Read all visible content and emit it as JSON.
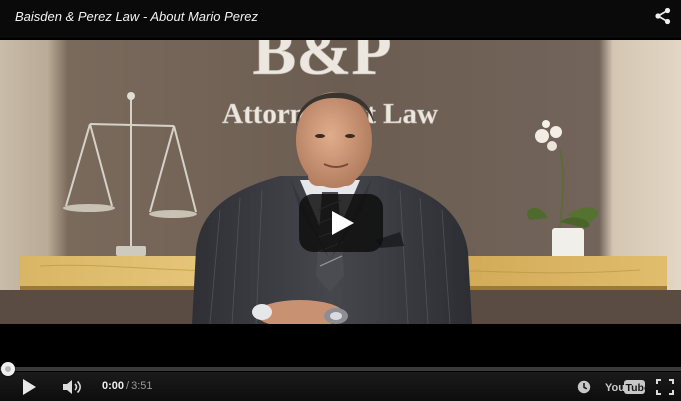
{
  "video": {
    "title": "Baisden & Perez Law - About Mario Perez",
    "sign_logo": "B&P",
    "sign_subtitle": "Attorneys at Law"
  },
  "player": {
    "current_time": "0:00",
    "time_separator": "/",
    "duration": "3:51",
    "progress_fraction": 0,
    "brand": "YouTube"
  },
  "icons": {
    "share": "share-icon",
    "big_play": "play-icon",
    "play": "play-icon",
    "volume": "volume-icon",
    "watch_later": "clock-icon",
    "youtube": "youtube-logo-icon",
    "fullscreen": "fullscreen-icon"
  },
  "colors": {
    "background": "#000000",
    "wall": "#6e6258",
    "marble_counter": "#d8b060",
    "suit": "#3b3d42",
    "progress_fill": "#c8c8c8"
  }
}
